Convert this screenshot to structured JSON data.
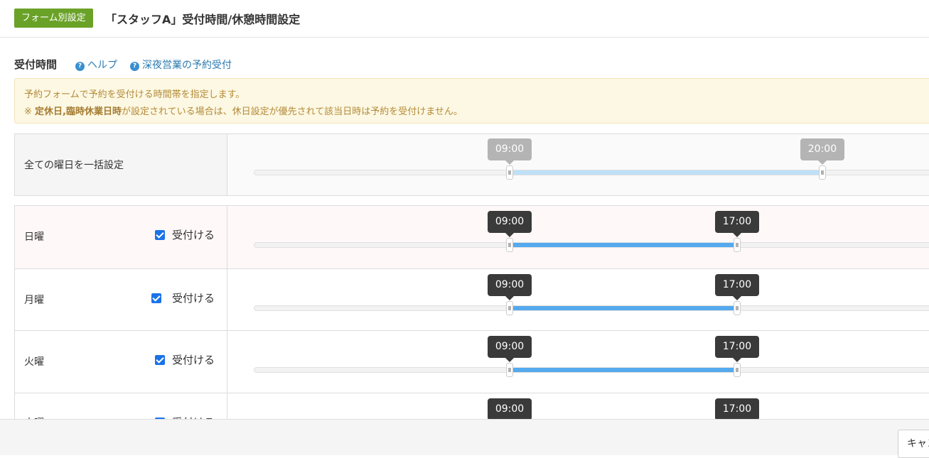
{
  "header": {
    "badge": "フォーム別設定",
    "title": "「スタッフA」受付時間/休憩時間設定"
  },
  "section": {
    "title": "受付時間",
    "help_link": "ヘルプ",
    "late_night_link": "深夜営業の予約受付"
  },
  "notice": {
    "line1": "予約フォームで予約を受付ける時間帯を指定します。",
    "line2_prefix": "※",
    "line2_bold": "定休日,臨時休業日時",
    "line2_rest": "が設定されている場合は、休日設定が優先されて該当日時は予約を受付けません。"
  },
  "bulk": {
    "label": "全ての曜日を一括設定",
    "start": "09:00",
    "end": "20:00",
    "start_fraction": 0.375,
    "end_fraction": 0.8333
  },
  "accept_label": "受付ける",
  "days": [
    {
      "name": "日曜",
      "checked": true,
      "start": "09:00",
      "end": "17:00",
      "start_fraction": 0.375,
      "end_fraction": 0.7083
    },
    {
      "name": "月曜",
      "checked": true,
      "start": "09:00",
      "end": "17:00",
      "start_fraction": 0.375,
      "end_fraction": 0.7083
    },
    {
      "name": "火曜",
      "checked": true,
      "start": "09:00",
      "end": "17:00",
      "start_fraction": 0.375,
      "end_fraction": 0.7083
    },
    {
      "name": "水曜",
      "checked": true,
      "start": "09:00",
      "end": "17:00",
      "start_fraction": 0.375,
      "end_fraction": 0.7083
    }
  ],
  "footer": {
    "cancel_label": "キャンセル"
  },
  "colors": {
    "badge_bg": "#6aa228",
    "slider_fill": "#55aaee",
    "slider_fill_disabled": "#bfe0f8",
    "tooltip_dark": "#3a3a3a",
    "tooltip_grey": "#b4b4b4",
    "notice_bg": "#fcf8e3",
    "sunday_row_bg": "#fff8f8"
  }
}
